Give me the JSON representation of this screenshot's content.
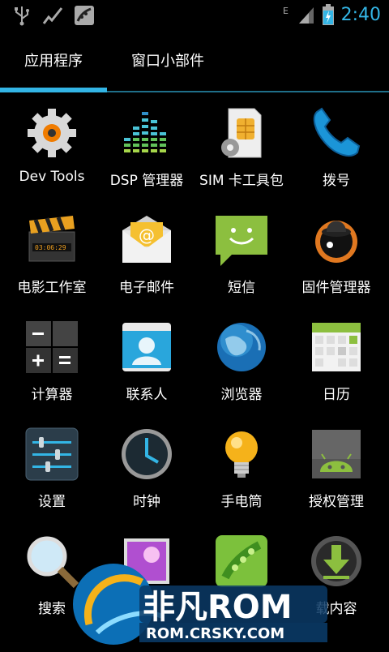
{
  "status_bar": {
    "time": "2:40",
    "left_icons": [
      "usb-icon",
      "activity-icon",
      "pea-pod-icon"
    ],
    "right_icons": [
      "data-icon",
      "signal-icon",
      "battery-icon"
    ]
  },
  "tabs": [
    {
      "label": "应用程序",
      "active": true
    },
    {
      "label": "窗口小部件",
      "active": false
    }
  ],
  "apps": [
    {
      "label": "Dev Tools",
      "icon": "gear-icon"
    },
    {
      "label": "DSP 管理器",
      "icon": "equalizer-icon"
    },
    {
      "label": "SIM 卡工具包",
      "icon": "sim-card-icon"
    },
    {
      "label": "拨号",
      "icon": "phone-icon"
    },
    {
      "label": "电影工作室",
      "icon": "clapperboard-icon"
    },
    {
      "label": "电子邮件",
      "icon": "email-icon"
    },
    {
      "label": "短信",
      "icon": "sms-icon"
    },
    {
      "label": "固件管理器",
      "icon": "bowler-hat-icon"
    },
    {
      "label": "计算器",
      "icon": "calculator-icon"
    },
    {
      "label": "联系人",
      "icon": "contacts-icon"
    },
    {
      "label": "浏览器",
      "icon": "globe-icon"
    },
    {
      "label": "日历",
      "icon": "calendar-icon"
    },
    {
      "label": "设置",
      "icon": "settings-sliders-icon"
    },
    {
      "label": "时钟",
      "icon": "clock-icon"
    },
    {
      "label": "手电筒",
      "icon": "light-bulb-icon"
    },
    {
      "label": "授权管理",
      "icon": "android-icon"
    },
    {
      "label": "搜索",
      "icon": "magnifier-icon"
    },
    {
      "label": "",
      "icon": "gallery-icon"
    },
    {
      "label": "",
      "icon": "pea-pod-app-icon"
    },
    {
      "label": "载内容",
      "icon": "download-icon"
    }
  ],
  "watermark": {
    "brand": "非凡ROM",
    "url": "ROM.CRSKY.COM"
  },
  "colors": {
    "accent": "#33b5e5",
    "background": "#000000"
  }
}
